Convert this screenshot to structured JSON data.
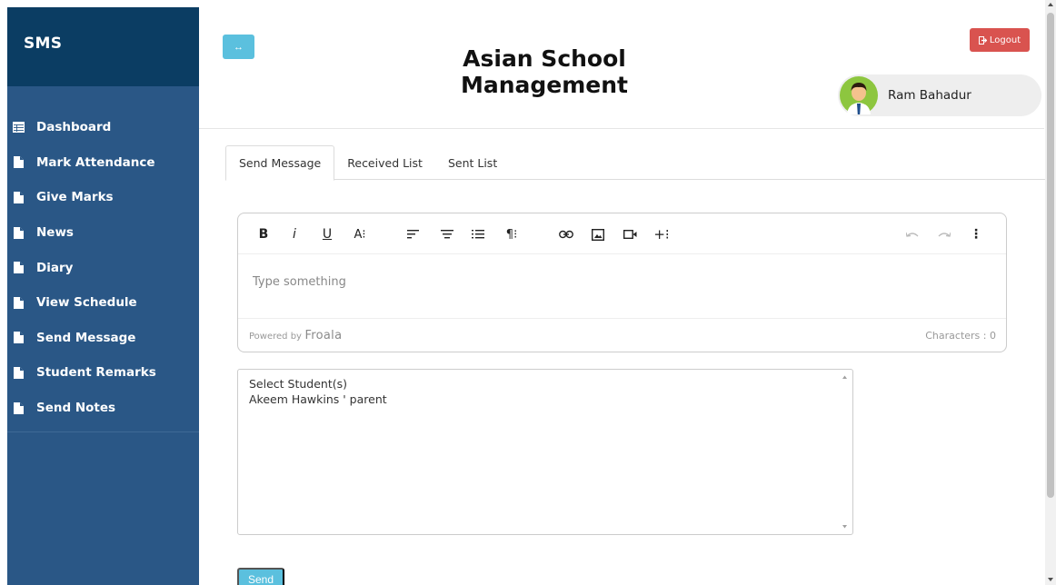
{
  "sidebar": {
    "brand": "SMS",
    "items": [
      {
        "label": "Dashboard",
        "icon": "table-icon"
      },
      {
        "label": "Mark Attendance",
        "icon": "file-icon"
      },
      {
        "label": "Give Marks",
        "icon": "file-icon"
      },
      {
        "label": "News",
        "icon": "file-icon"
      },
      {
        "label": "Diary",
        "icon": "file-icon"
      },
      {
        "label": "View Schedule",
        "icon": "file-icon"
      },
      {
        "label": "Send Message",
        "icon": "file-icon"
      },
      {
        "label": "Student Remarks",
        "icon": "file-icon"
      },
      {
        "label": "Send Notes",
        "icon": "file-icon"
      }
    ]
  },
  "header": {
    "toggle_label": "↔",
    "title": "Asian School Management",
    "logout_label": "Logout",
    "user_name": "Ram Bahadur"
  },
  "tabs": [
    {
      "label": "Send Message",
      "active": true
    },
    {
      "label": "Received List",
      "active": false
    },
    {
      "label": "Sent List",
      "active": false
    }
  ],
  "editor": {
    "placeholder": "Type something",
    "powered_by": "Powered by",
    "brand": "Froala",
    "characters": "Characters : 0",
    "toolbar": {
      "bold": "B",
      "italic": "i",
      "underline": "U",
      "font_size": "A⁝",
      "align": "align-left-icon",
      "paragraph_format": "paragraph-format-icon",
      "ordered_list": "ordered-list-icon",
      "paragraph_style": "¶⁝",
      "link": "link-icon",
      "image": "image-icon",
      "video": "video-icon",
      "insert_more": "+⁝",
      "undo": "undo-icon",
      "redo": "redo-icon",
      "more": "⋮"
    }
  },
  "select": {
    "options": [
      "Select Student(s)",
      "Akeem Hawkins ' parent"
    ]
  },
  "send_label": "Send",
  "colors": {
    "sidebar": "#2a5786",
    "brand_bar": "#0b3d63",
    "info": "#5bc0de",
    "danger": "#d9534f"
  }
}
